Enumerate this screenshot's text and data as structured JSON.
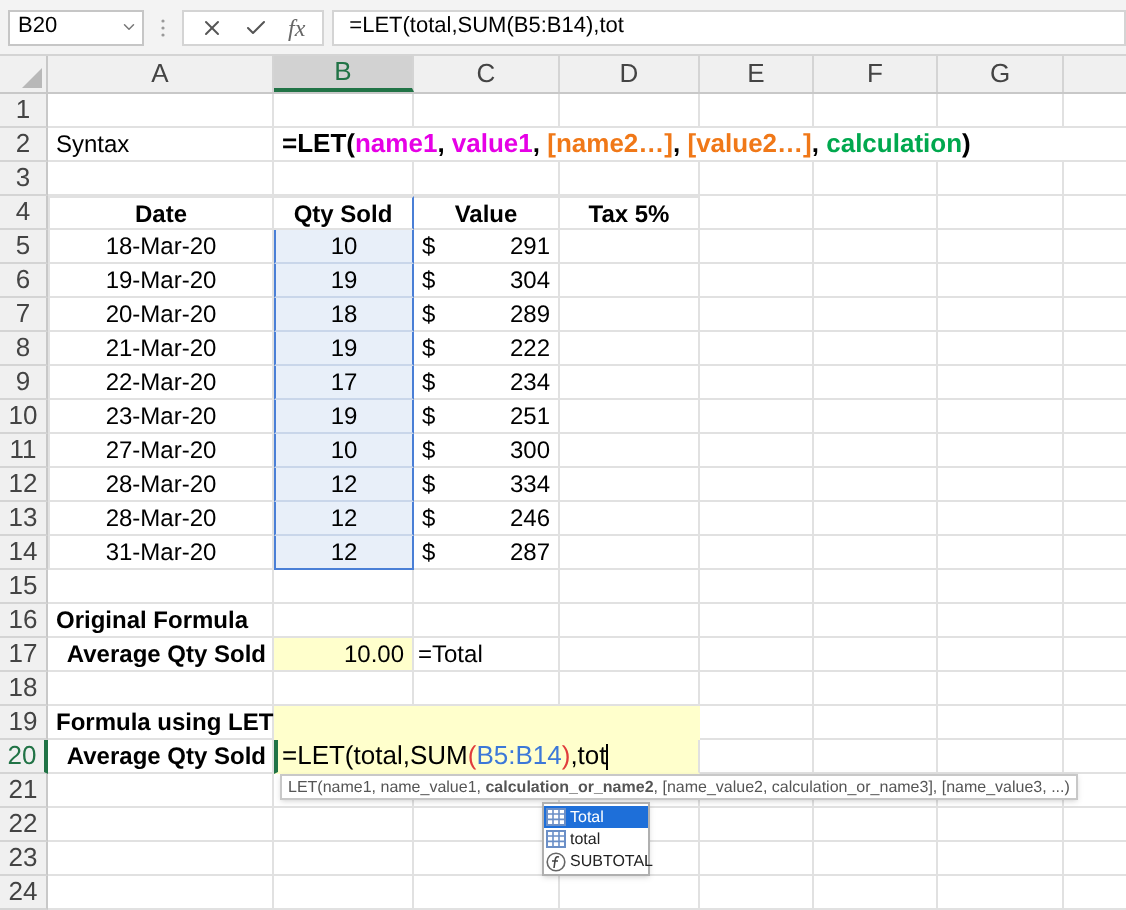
{
  "name_box": "B20",
  "formula_bar": {
    "function_label": "fx",
    "formula": "=LET(total,SUM(B5:B14),tot"
  },
  "columns": [
    {
      "label": "A",
      "selected": false
    },
    {
      "label": "B",
      "selected": true
    },
    {
      "label": "C",
      "selected": false
    },
    {
      "label": "D",
      "selected": false
    },
    {
      "label": "E",
      "selected": false
    },
    {
      "label": "F",
      "selected": false
    },
    {
      "label": "G",
      "selected": false
    }
  ],
  "row_numbers": [
    {
      "label": "1",
      "selected": false
    },
    {
      "label": "2",
      "selected": false
    },
    {
      "label": "3",
      "selected": false
    },
    {
      "label": "4",
      "selected": false
    },
    {
      "label": "5",
      "selected": false
    },
    {
      "label": "6",
      "selected": false
    },
    {
      "label": "7",
      "selected": false
    },
    {
      "label": "8",
      "selected": false
    },
    {
      "label": "9",
      "selected": false
    },
    {
      "label": "10",
      "selected": false
    },
    {
      "label": "11",
      "selected": false
    },
    {
      "label": "12",
      "selected": false
    },
    {
      "label": "13",
      "selected": false
    },
    {
      "label": "14",
      "selected": false
    },
    {
      "label": "15",
      "selected": false
    },
    {
      "label": "16",
      "selected": false
    },
    {
      "label": "17",
      "selected": false
    },
    {
      "label": "18",
      "selected": false
    },
    {
      "label": "19",
      "selected": false
    },
    {
      "label": "20",
      "selected": true
    },
    {
      "label": "21",
      "selected": false
    },
    {
      "label": "22",
      "selected": false
    },
    {
      "label": "23",
      "selected": false
    },
    {
      "label": "24",
      "selected": false
    }
  ],
  "syntax": {
    "label": "Syntax",
    "parts": [
      {
        "text": "=LET(",
        "color": "#000000"
      },
      {
        "text": "name1",
        "color": "#e600e6"
      },
      {
        "text": ", ",
        "color": "#000000"
      },
      {
        "text": "value1",
        "color": "#e600e6"
      },
      {
        "text": ", ",
        "color": "#000000"
      },
      {
        "text": "[name2…]",
        "color": "#f07818"
      },
      {
        "text": ", ",
        "color": "#000000"
      },
      {
        "text": "[value2…]",
        "color": "#f07818"
      },
      {
        "text": ", ",
        "color": "#000000"
      },
      {
        "text": "calculation",
        "color": "#00a84e"
      },
      {
        "text": ")",
        "color": "#000000"
      }
    ]
  },
  "table": {
    "headers": [
      "Date",
      "Qty Sold",
      "Value",
      "Tax 5%"
    ],
    "qty_highlighted": true,
    "rows": [
      {
        "date": "18-Mar-20",
        "qty": "10",
        "currency": "$",
        "value": "291"
      },
      {
        "date": "19-Mar-20",
        "qty": "19",
        "currency": "$",
        "value": "304"
      },
      {
        "date": "20-Mar-20",
        "qty": "18",
        "currency": "$",
        "value": "289"
      },
      {
        "date": "21-Mar-20",
        "qty": "19",
        "currency": "$",
        "value": "222"
      },
      {
        "date": "22-Mar-20",
        "qty": "17",
        "currency": "$",
        "value": "234"
      },
      {
        "date": "23-Mar-20",
        "qty": "19",
        "currency": "$",
        "value": "251"
      },
      {
        "date": "27-Mar-20",
        "qty": "10",
        "currency": "$",
        "value": "300"
      },
      {
        "date": "28-Mar-20",
        "qty": "12",
        "currency": "$",
        "value": "334"
      },
      {
        "date": "28-Mar-20",
        "qty": "12",
        "currency": "$",
        "value": "246"
      },
      {
        "date": "31-Mar-20",
        "qty": "12",
        "currency": "$",
        "value": "287"
      }
    ]
  },
  "original_formula": {
    "title": "Original Formula",
    "label": "Average Qty Sold",
    "value": "10.00",
    "note": "=Total"
  },
  "let_formula": {
    "title": "Formula using LET",
    "label": "Average Qty Sold",
    "parts": [
      {
        "text": "=LET(total,SUM",
        "color": "#000000"
      },
      {
        "text": "(",
        "color": "#e03c3c"
      },
      {
        "text": "B5:B14",
        "color": "#3c78d8"
      },
      {
        "text": ")",
        "color": "#e03c3c"
      },
      {
        "text": ",tot",
        "color": "#000000"
      }
    ]
  },
  "tooltip": "LET(name1, name_value1, **calculation_or_name2**, [name_value2, calculation_or_name3], [name_value3, ...)",
  "autocomplete": [
    {
      "label": "Total",
      "kind": "name",
      "selected": true
    },
    {
      "label": "total",
      "kind": "name",
      "selected": false
    },
    {
      "label": "SUBTOTAL",
      "kind": "function",
      "selected": false
    }
  ]
}
